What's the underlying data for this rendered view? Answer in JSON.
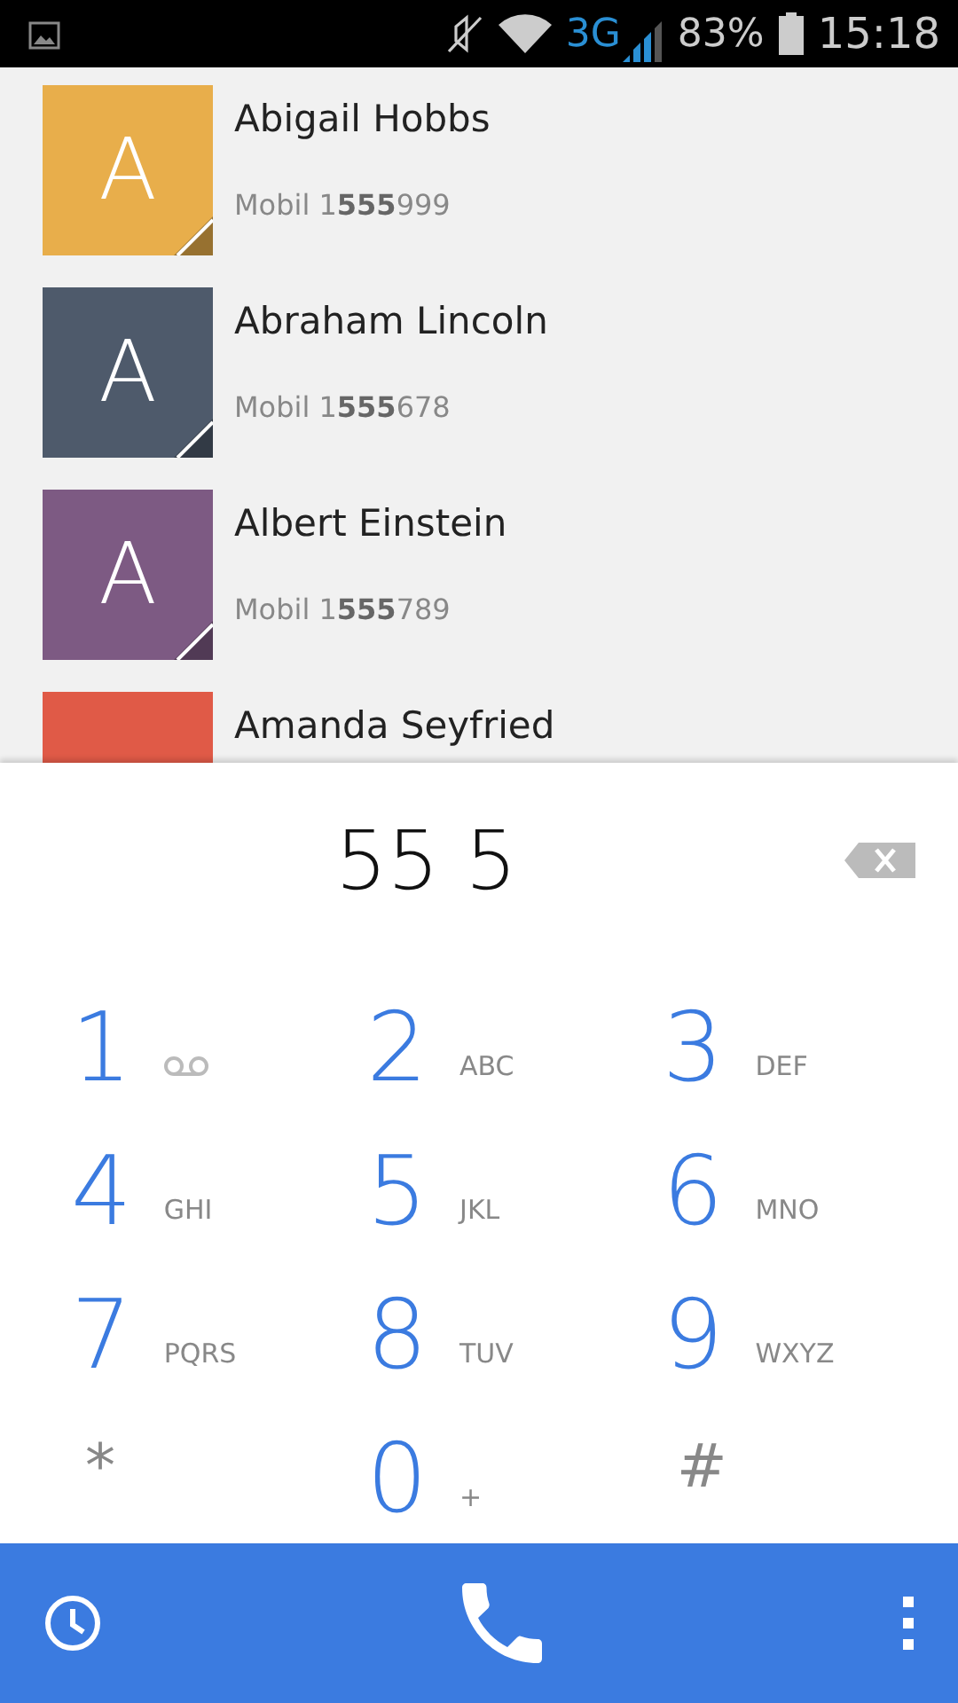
{
  "status_bar": {
    "network": "3G",
    "battery": "83%",
    "time": "15:18"
  },
  "contacts": [
    {
      "initial": "A",
      "color": "#e8ae4b",
      "name": "Abigail Hobbs",
      "phone": "Mobil 1**555**999"
    },
    {
      "initial": "A",
      "color": "#4e5a6b",
      "name": "Abraham Lincoln",
      "phone": "Mobil 1**555**678"
    },
    {
      "initial": "A",
      "color": "#7d5a83",
      "name": "Albert Einstein",
      "phone": "Mobil 1**555**789"
    },
    {
      "color": "#e05a47",
      "name": "Amanda Seyfried"
    }
  ],
  "number": "55 5",
  "keys": [
    {
      "kind": "voicemail",
      "digit": "1"
    },
    {
      "kind": "digit",
      "digit": "2",
      "letters": "ABC"
    },
    {
      "kind": "digit",
      "digit": "3",
      "letters": "DEF"
    },
    {
      "kind": "digit",
      "digit": "4",
      "letters": "GHI"
    },
    {
      "kind": "digit",
      "digit": "5",
      "letters": "JKL"
    },
    {
      "kind": "digit",
      "digit": "6",
      "letters": "MNO"
    },
    {
      "kind": "digit",
      "digit": "7",
      "letters": "PQRS"
    },
    {
      "kind": "digit",
      "digit": "8",
      "letters": "TUV"
    },
    {
      "kind": "digit",
      "digit": "9",
      "letters": "WXYZ"
    },
    {
      "kind": "symbol",
      "digit": "*"
    },
    {
      "kind": "digit",
      "digit": "0",
      "letters": "+"
    },
    {
      "kind": "symbol",
      "digit": "#"
    }
  ]
}
